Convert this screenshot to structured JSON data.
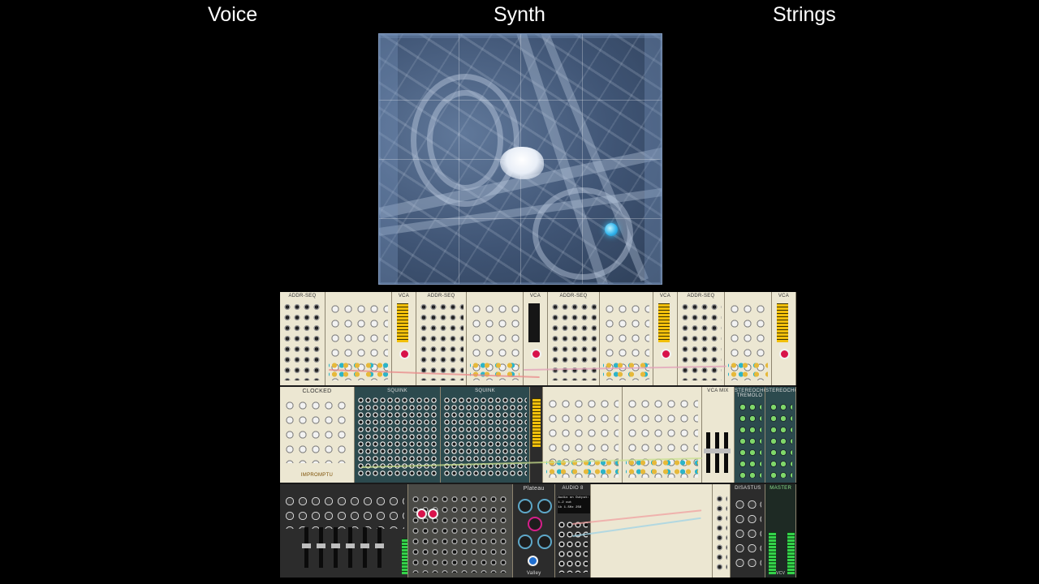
{
  "headers": {
    "left": "Voice",
    "center": "Synth",
    "right": "Strings"
  },
  "rack": {
    "row1_modules": [
      "ADDR-SEQ",
      "ADDR-SEQ",
      "ADDR-SEQ",
      "ADDR-SEQ",
      "VCA",
      "VCA",
      "VCA",
      "VCA"
    ],
    "clock_title": "CLOCKED",
    "clock_brand": "IMPROMPTU",
    "squinks": [
      "SQUINK",
      "SQUINK"
    ],
    "mixer_title": "VCA MIX",
    "stereo_title": "STEREOCHORUS TREMOLO",
    "stereo_title2": "STEREOCHORUS",
    "plateau_title": "Plateau",
    "plateau_brand": "Valley",
    "audio_title": "AUDIO 8",
    "audio_line1": "Audio on Output: 1-2 out",
    "audio_line2": "1k 1.5Hz   256",
    "disastus_title": "DISASTUS",
    "master_title": "MASTER",
    "master_brand": "VCV"
  }
}
